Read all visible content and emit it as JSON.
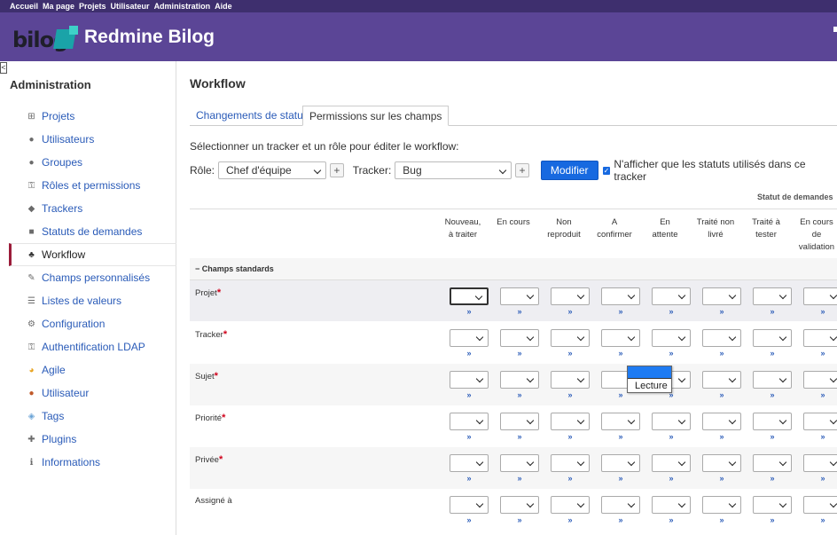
{
  "top_menu": [
    "Accueil",
    "Ma page",
    "Projets",
    "Utilisateur",
    "Administration",
    "Aide"
  ],
  "header": {
    "logo_text": "bilog",
    "site_title": "Redmine Bilog"
  },
  "sidebar": {
    "collapse_label": "<",
    "title": "Administration",
    "items": [
      {
        "label": "Projets",
        "icon": "projects-icon"
      },
      {
        "label": "Utilisateurs",
        "icon": "user-icon"
      },
      {
        "label": "Groupes",
        "icon": "group-icon"
      },
      {
        "label": "Rôles et permissions",
        "icon": "key-icon"
      },
      {
        "label": "Trackers",
        "icon": "tag-icon"
      },
      {
        "label": "Statuts de demandes",
        "icon": "status-icon"
      },
      {
        "label": "Workflow",
        "icon": "workflow-icon",
        "selected": true
      },
      {
        "label": "Champs personnalisés",
        "icon": "edit-icon"
      },
      {
        "label": "Listes de valeurs",
        "icon": "list-icon"
      },
      {
        "label": "Configuration",
        "icon": "gear-icon"
      },
      {
        "label": "Authentification LDAP",
        "icon": "key-icon"
      },
      {
        "label": "Agile",
        "icon": "agile-icon"
      },
      {
        "label": "Utilisateur",
        "icon": "person-icon"
      },
      {
        "label": "Tags",
        "icon": "tags-icon"
      },
      {
        "label": "Plugins",
        "icon": "plugin-icon"
      },
      {
        "label": "Informations",
        "icon": "info-icon"
      }
    ]
  },
  "content": {
    "title": "Workflow",
    "tabs": [
      {
        "label": "Changements de statut",
        "active": false
      },
      {
        "label": "Permissions sur les champs",
        "active": true
      }
    ],
    "instruction": "Sélectionner un tracker et un rôle pour éditer le workflow:",
    "filters": {
      "role_label": "Rôle:",
      "role_value": "Chef d'équipe",
      "tracker_label": "Tracker:",
      "tracker_value": "Bug",
      "plus": "+",
      "submit": "Modifier",
      "checkbox_checked": true,
      "checkbox_label": "N'afficher que les statuts utilisés dans ce tracker"
    },
    "table": {
      "status_caption": "Statut de demandes",
      "columns": [
        [
          "Nouveau,",
          "à traiter"
        ],
        [
          "En cours",
          ""
        ],
        [
          "Non",
          "reproduit"
        ],
        [
          "A",
          "confirmer"
        ],
        [
          "En",
          "attente"
        ],
        [
          "Traité non",
          "livré"
        ],
        [
          "Traité à",
          "tester"
        ],
        [
          "En cours",
          "de",
          "validation"
        ]
      ],
      "section": "− Champs standards",
      "rows": [
        {
          "name": "Projet",
          "required": true
        },
        {
          "name": "Tracker",
          "required": true
        },
        {
          "name": "Sujet",
          "required": true
        },
        {
          "name": "Priorité",
          "required": true
        },
        {
          "name": "Privée",
          "required": true
        },
        {
          "name": "Assigné à",
          "required": false
        }
      ],
      "required_mark": "*",
      "copy_mark": "»",
      "dropdown_options": [
        "",
        "Lecture"
      ]
    }
  }
}
